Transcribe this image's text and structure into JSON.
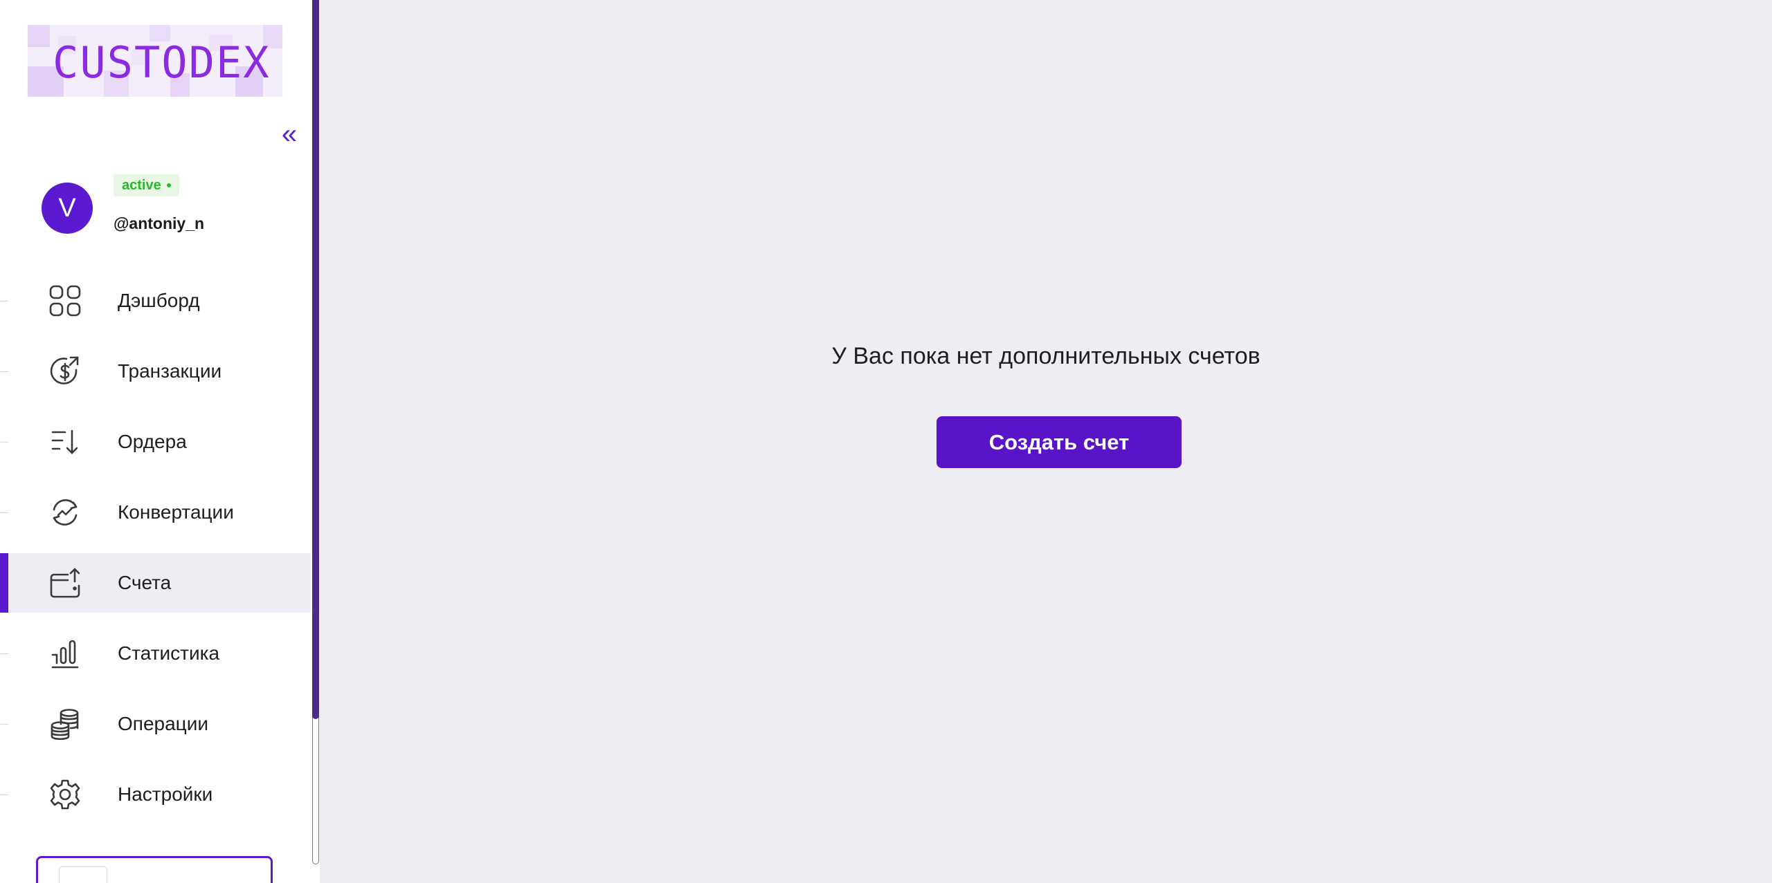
{
  "brand": {
    "logo_text": "CUSTODEX"
  },
  "sidebar": {
    "collapse_label": "«",
    "user": {
      "avatar_initial": "V",
      "status": "active",
      "username": "@antoniy_n"
    },
    "items": [
      {
        "label": "Дэшборд",
        "icon": "dashboard-grid-icon",
        "active": false
      },
      {
        "label": "Транзакции",
        "icon": "dollar-cycle-icon",
        "active": false
      },
      {
        "label": "Ордера",
        "icon": "sort-list-icon",
        "active": false
      },
      {
        "label": "Конвертации",
        "icon": "conversion-icon",
        "active": false
      },
      {
        "label": "Счета",
        "icon": "wallet-icon",
        "active": true
      },
      {
        "label": "Статистика",
        "icon": "bar-chart-icon",
        "active": false
      },
      {
        "label": "Операции",
        "icon": "coins-stack-icon",
        "active": false
      },
      {
        "label": "Настройки",
        "icon": "gear-icon",
        "active": false
      }
    ]
  },
  "main": {
    "empty_message": "У Вас пока нет дополнительных счетов",
    "create_button_label": "Создать счет"
  },
  "colors": {
    "accent": "#5a1ad0",
    "background": "#efedf4",
    "status_green": "#28b82a"
  }
}
